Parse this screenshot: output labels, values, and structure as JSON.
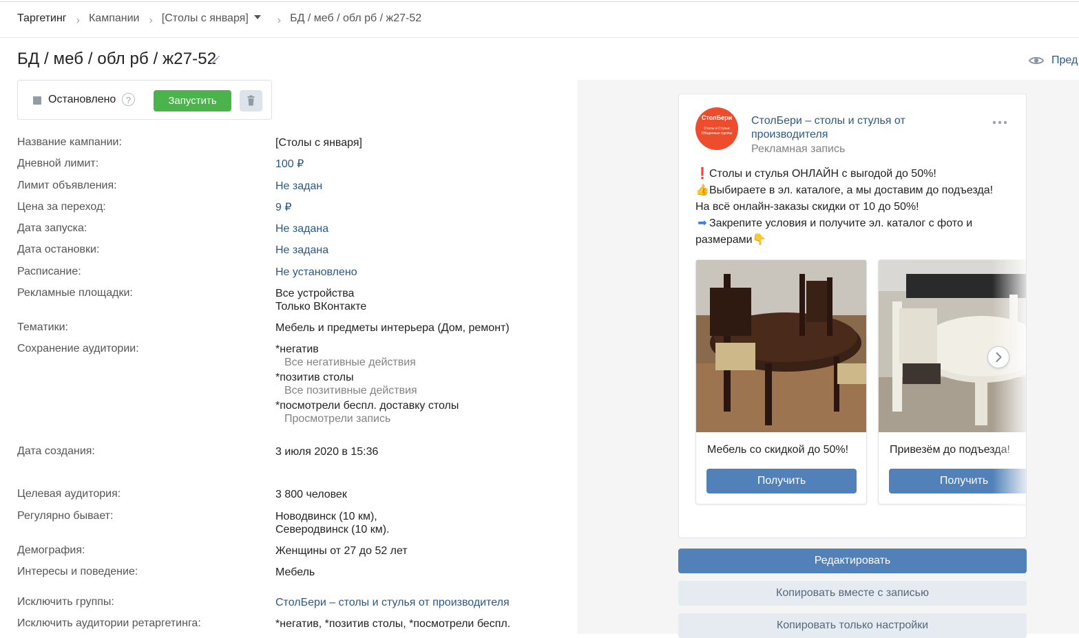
{
  "breadcrumb": {
    "items": [
      "Таргетинг",
      "Кампании",
      "[Столы с января]",
      "БД / меб / обл рб / ж27-52"
    ]
  },
  "title": "БД / меб / обл рб / ж27-52",
  "preview_label": "Пред",
  "status": {
    "text": "Остановлено",
    "help": "?",
    "start_label": "Запустить"
  },
  "fields": {
    "campaign_name": {
      "label": "Название кампании:",
      "value": "[Столы с января]"
    },
    "daily_limit": {
      "label": "Дневной лимит:",
      "value": "100 ₽"
    },
    "ad_limit": {
      "label": "Лимит объявления:",
      "value": "Не задан"
    },
    "cpc": {
      "label": "Цена за переход:",
      "value": "9 ₽"
    },
    "start_date": {
      "label": "Дата запуска:",
      "value": "Не задана"
    },
    "stop_date": {
      "label": "Дата остановки:",
      "value": "Не задана"
    },
    "schedule": {
      "label": "Расписание:",
      "value": "Не установлено"
    },
    "platforms": {
      "label": "Рекламные площадки:",
      "line1": "Все устройства",
      "line2": "Только ВКонтакте"
    },
    "topics": {
      "label": "Тематики:",
      "value": "Мебель и предметы интерьера (Дом, ремонт)"
    },
    "audience_save": {
      "label": "Сохранение аудитории:",
      "items": [
        {
          "name": "*негатив",
          "sub": "Все негативные действия"
        },
        {
          "name": "*позитив столы",
          "sub": "Все позитивные действия"
        },
        {
          "name": "*посмотрели беспл. доставку столы",
          "sub": "Просмотрели запись"
        }
      ]
    },
    "created": {
      "label": "Дата создания:",
      "value": "3 июля 2020 в 15:36"
    },
    "target_audience": {
      "label": "Целевая аудитория:",
      "value": "3 800 человек"
    },
    "regular": {
      "label": "Регулярно бывает:",
      "line1": "Новодвинск (10 км),",
      "line2": "Северодвинск (10 км)."
    },
    "demography": {
      "label": "Демография:",
      "value": "Женщины от 27 до 52 лет"
    },
    "interests": {
      "label": "Интересы и поведение:",
      "value": "Мебель"
    },
    "exclude_groups": {
      "label": "Исключить группы:",
      "value": "СтолБери – столы и стулья от производителя"
    },
    "exclude_retarget": {
      "label": "Исключить аудитории ретаргетинга:",
      "value": "*негатив, *позитив столы, *посмотрели беспл."
    }
  },
  "post": {
    "avatar_text1": "СтолБери",
    "avatar_text2": "Столы и Стулья Обеденные группы",
    "author": "СтолБери – столы и стулья от производителя",
    "sub": "Рекламная запись",
    "lines": [
      {
        "emoji": "❗",
        "text": "Столы и стулья ОНЛАЙН с выгодой до 50%!"
      },
      {
        "emoji": "👍",
        "text": "Выбираете в эл. каталоге, а мы доставим до подъезда!"
      },
      {
        "emoji": "",
        "text": "На всё онлайн-заказы скидки от 10 до 50%!"
      },
      {
        "emoji": "➡",
        "text": "Закрепите условия и получите эл. каталог с фото и"
      },
      {
        "emoji": "",
        "text": "размерами👇"
      }
    ],
    "cards": [
      {
        "caption": "Мебель со скидкой до 50%!",
        "button": "Получить"
      },
      {
        "caption": "Привезём до подъезда!",
        "button": "Получить"
      }
    ]
  },
  "actions": {
    "edit": "Редактировать",
    "copy_with_post": "Копировать вместе с записью",
    "copy_settings": "Копировать только настройки"
  },
  "colors": {
    "link": "#2a5885",
    "start_button": "#4bb34b",
    "vk_blue": "#5181b8",
    "secondary_button": "#e5ebf1"
  }
}
